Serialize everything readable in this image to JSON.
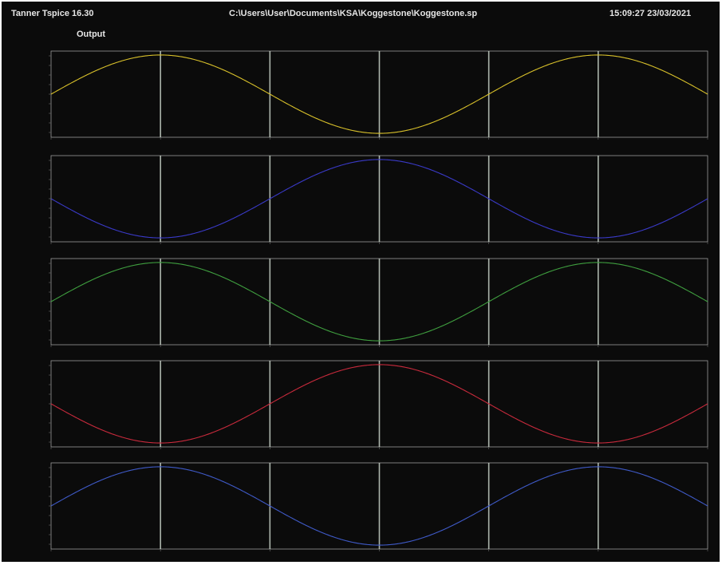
{
  "header": {
    "app_title": "Tanner  Tspice 16.30",
    "file_path": "C:\\Users\\User\\Documents\\KSA\\Koggestone\\Koggestone.sp",
    "timestamp": "15:09:27    23/03/2021",
    "output_label": "Output"
  },
  "colors": {
    "background": "#0b0b0b",
    "frame": "#9a9a9a",
    "marker": "#c9d3c9"
  },
  "chart_data": [
    {
      "type": "line",
      "series": [
        {
          "color": "#d8c02a",
          "phase": 0.0
        }
      ],
      "x_range": [
        0,
        6
      ],
      "ylim": [
        -1.1,
        1.1
      ],
      "x_markers": [
        1,
        2,
        3,
        4,
        5
      ],
      "grid": false
    },
    {
      "type": "line",
      "series": [
        {
          "color": "#3a3ac8",
          "phase": 3.14159
        }
      ],
      "x_range": [
        0,
        6
      ],
      "ylim": [
        -1.1,
        1.1
      ],
      "x_markers": [
        1,
        2,
        3,
        4,
        5
      ],
      "grid": false
    },
    {
      "type": "line",
      "series": [
        {
          "color": "#3f9f3f",
          "phase": 0.0
        }
      ],
      "x_range": [
        0,
        6
      ],
      "ylim": [
        -1.1,
        1.1
      ],
      "x_markers": [
        1,
        2,
        3,
        4,
        5
      ],
      "grid": false
    },
    {
      "type": "line",
      "series": [
        {
          "color": "#c82a3c",
          "phase": 3.14159
        }
      ],
      "x_range": [
        0,
        6
      ],
      "ylim": [
        -1.1,
        1.1
      ],
      "x_markers": [
        1,
        2,
        3,
        4,
        5
      ],
      "grid": false
    },
    {
      "type": "line",
      "series": [
        {
          "color": "#3f5ac8",
          "phase": 0.0
        }
      ],
      "x_range": [
        0,
        6
      ],
      "ylim": [
        -1.1,
        1.1
      ],
      "x_markers": [
        1,
        2,
        3,
        4,
        5
      ],
      "grid": false
    }
  ]
}
